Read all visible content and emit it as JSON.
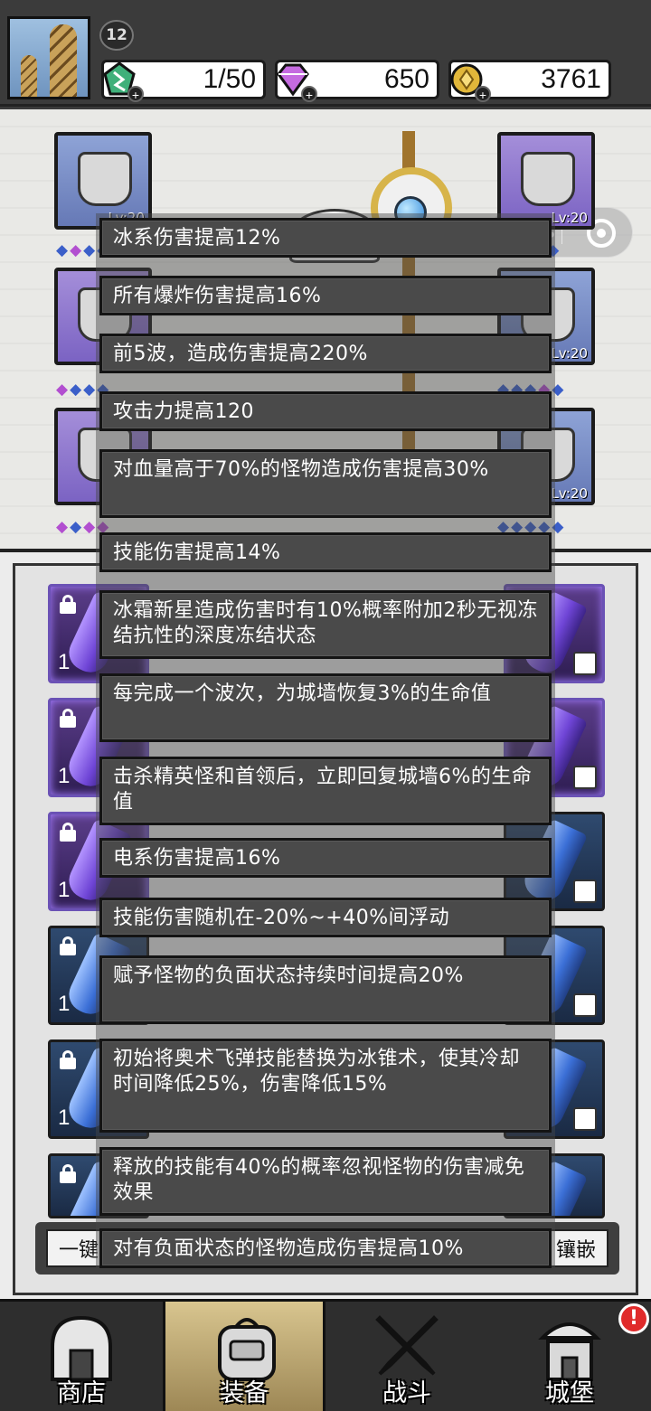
{
  "header": {
    "level": "12",
    "resources": [
      {
        "name": "energy",
        "value": "1/50",
        "icon": "green-crystal-icon",
        "color": "#3fb07a"
      },
      {
        "name": "gems",
        "value": "650",
        "icon": "purple-diamond-icon",
        "color": "#c56be0"
      },
      {
        "name": "gold",
        "value": "3761",
        "icon": "gold-coin-icon",
        "color": "#e1b73a"
      }
    ]
  },
  "equipment": {
    "slots": [
      {
        "id": "helmet",
        "level": "Lv:20"
      },
      {
        "id": "arm",
        "level": "Lv:20"
      },
      {
        "id": "armor",
        "level": ""
      },
      {
        "id": "ring",
        "level": "Lv:20"
      },
      {
        "id": "boots",
        "level": ""
      },
      {
        "id": "necklace",
        "level": "Lv:20"
      }
    ]
  },
  "inventory": {
    "buttons": {
      "left": "一键",
      "right": "镶嵌"
    }
  },
  "tooltip": {
    "effects": [
      "冰系伤害提高12%",
      "所有爆炸伤害提高16%",
      "前5波，造成伤害提高220%",
      "攻击力提高120",
      "对血量高于70%的怪物造成伤害提高30%",
      "技能伤害提高14%",
      "冰霜新星造成伤害时有10%概率附加2秒无视冻结抗性的深度冻结状态",
      "每完成一个波次，为城墙恢复3%的生命值",
      "击杀精英怪和首领后，立即回复城墙6%的生命值",
      "电系伤害提高16%",
      "技能伤害随机在-20%~+40%间浮动",
      "赋予怪物的负面状态持续时间提高20%",
      "初始将奥术飞弹技能替换为冰锥术，使其冷却时间降低25%，伤害降低15%",
      "释放的技能有40%的概率忽视怪物的伤害减免效果",
      "对有负面状态的怪物造成伤害提高10%"
    ]
  },
  "nav": {
    "items": [
      {
        "label": "商店",
        "icon": "shop-icon"
      },
      {
        "label": "装备",
        "icon": "backpack-icon"
      },
      {
        "label": "战斗",
        "icon": "crossed-swords-icon"
      },
      {
        "label": "城堡",
        "icon": "castle-icon",
        "badge": "!"
      }
    ]
  }
}
